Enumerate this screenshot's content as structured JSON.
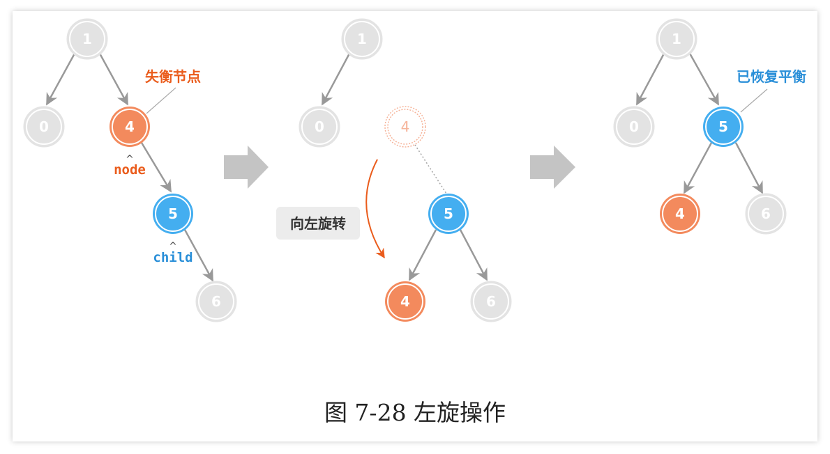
{
  "colors": {
    "faded_fill": "#e3e3e3",
    "faded_text": "#ffffff",
    "orange": "#f38a5d",
    "orange_label": "#ea5c1c",
    "blue": "#44aef0",
    "blue_label": "#2a8fd8",
    "edge": "#999999",
    "arrow_block": "#c4c4c4",
    "rotate_box": "#ececec"
  },
  "panels": [
    {
      "nodes": {
        "n1": {
          "label": "1",
          "style": "faded"
        },
        "n0": {
          "label": "0",
          "style": "faded"
        },
        "n4": {
          "label": "4",
          "style": "orange"
        },
        "n5": {
          "label": "5",
          "style": "blue"
        },
        "n6": {
          "label": "6",
          "style": "faded"
        }
      },
      "annotations": {
        "imbalanced": "失衡节点",
        "node_pointer": "node",
        "child_pointer": "child"
      }
    },
    {
      "nodes": {
        "n1": {
          "label": "1",
          "style": "faded"
        },
        "n0": {
          "label": "0",
          "style": "faded"
        },
        "n4_ghost": {
          "label": "4",
          "style": "ghost"
        },
        "n5": {
          "label": "5",
          "style": "blue"
        },
        "n4": {
          "label": "4",
          "style": "orange"
        },
        "n6": {
          "label": "6",
          "style": "faded"
        }
      },
      "annotations": {
        "rotate": "向左旋转"
      }
    },
    {
      "nodes": {
        "n1": {
          "label": "1",
          "style": "faded"
        },
        "n0": {
          "label": "0",
          "style": "faded"
        },
        "n5": {
          "label": "5",
          "style": "blue"
        },
        "n4": {
          "label": "4",
          "style": "orange"
        },
        "n6": {
          "label": "6",
          "style": "faded"
        }
      },
      "annotations": {
        "rebalanced": "已恢复平衡"
      }
    }
  ],
  "caption": "图 7-28   左旋操作"
}
